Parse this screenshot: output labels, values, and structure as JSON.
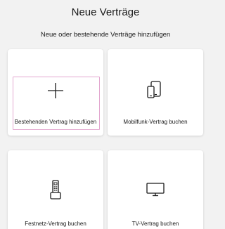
{
  "header": {
    "title": "Neue Verträge",
    "subtitle": "Neue oder bestehende Verträge hinzufügen"
  },
  "options": [
    {
      "label": "Bestehenden Vertrag hinzufügen",
      "icon": "plus-icon",
      "focused": true
    },
    {
      "label": "Mobilfunk-Vertrag buchen",
      "icon": "mobile-phones-icon",
      "focused": false
    },
    {
      "label": "Festnetz-Vertrag buchen",
      "icon": "landline-phone-icon",
      "focused": false
    },
    {
      "label": "TV-Vertrag buchen",
      "icon": "tv-icon",
      "focused": false
    }
  ],
  "colors": {
    "background": "#f2f2f2",
    "card": "#ffffff",
    "focus_outline": "#e3a7cf",
    "text": "#1a1a1a"
  }
}
